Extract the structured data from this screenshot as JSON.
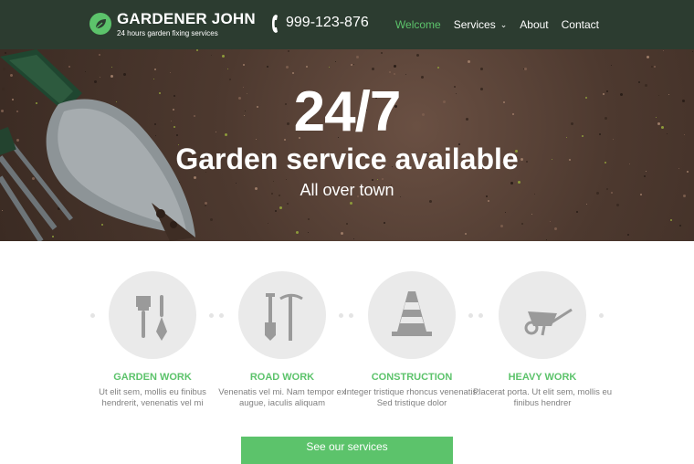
{
  "header": {
    "brand_name": "GARDENER JOHN",
    "tagline": "24 hours garden fixing services",
    "phone": "999-123-876",
    "nav": [
      {
        "label": "Welcome",
        "active": true
      },
      {
        "label": "Services",
        "active": false,
        "has_dropdown": true
      },
      {
        "label": "About",
        "active": false
      },
      {
        "label": "Contact",
        "active": false
      }
    ]
  },
  "hero": {
    "headline": "24/7",
    "subheadline": "Garden service available",
    "tagline": "All over town"
  },
  "services": [
    {
      "icon": "brush-trowel-icon",
      "title": "GARDEN WORK",
      "text": "Ut elit sem, mollis eu finibus hendrerit, venenatis vel mi"
    },
    {
      "icon": "shovel-pickaxe-icon",
      "title": "ROAD WORK",
      "text": "Venenatis vel mi. Nam tempor ex augue, iaculis aliquam"
    },
    {
      "icon": "traffic-cone-icon",
      "title": "CONSTRUCTION",
      "text": "Integer tristique rhoncus venenatis. Sed tristique dolor"
    },
    {
      "icon": "wheelbarrow-icon",
      "title": "HEAVY WORK",
      "text": "Placerat porta. Ut elit sem, mollis eu finibus hendrer"
    }
  ],
  "cta": {
    "label": "See our services"
  },
  "colors": {
    "accent": "#5cc36b",
    "header_bg": "#2c3c30",
    "icon_gray": "#9a9a9a"
  }
}
